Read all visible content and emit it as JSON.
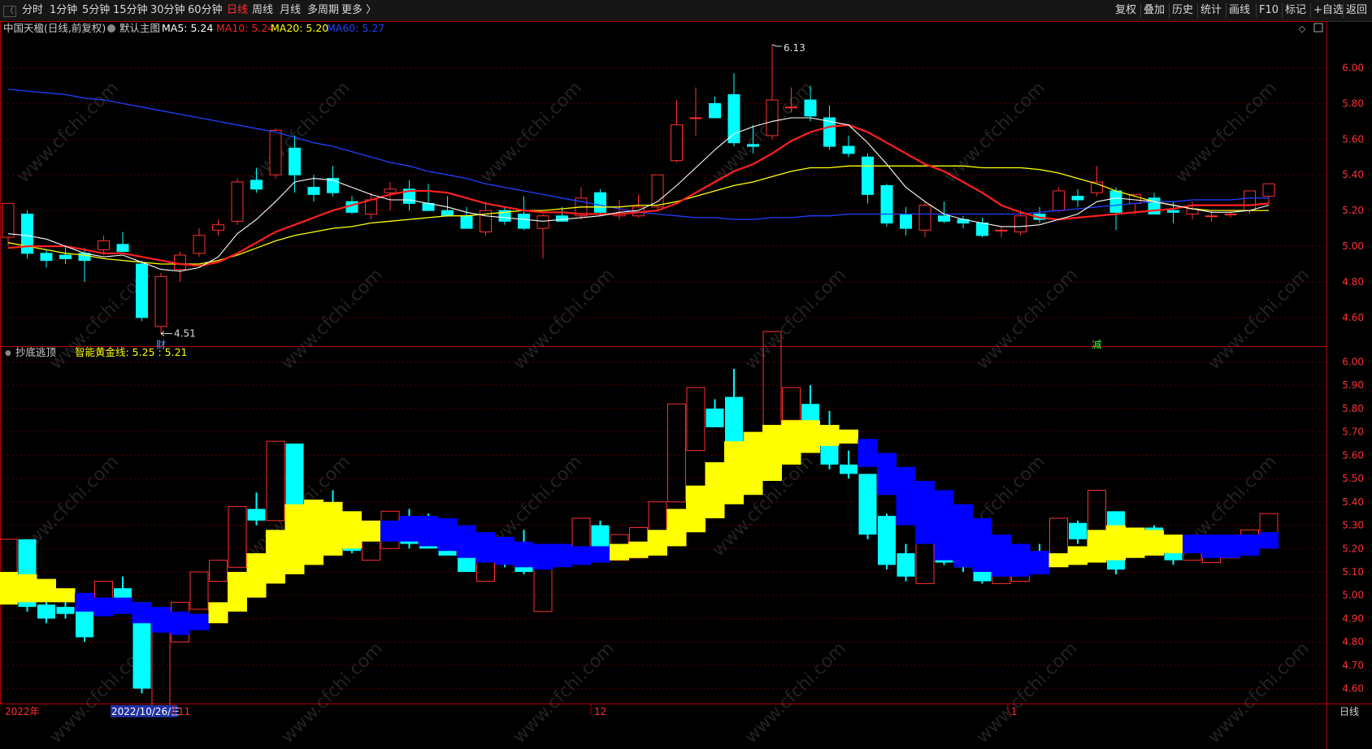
{
  "toolbar": {
    "collapse_glyph": "〈",
    "periods": [
      "分时",
      "1分钟",
      "5分钟",
      "15分钟",
      "30分钟",
      "60分钟",
      "日线",
      "周线",
      "月线",
      "多周期",
      "更多 〉"
    ],
    "active_period": "日线",
    "right_buttons": [
      "复权",
      "叠加",
      "历史",
      "统计",
      "画线",
      "F10",
      "标记",
      "+自选",
      "返回"
    ]
  },
  "main_panel": {
    "stock_title": "中国天楹(日线,前复权)",
    "template_label": "默认主图",
    "ma_legend": [
      {
        "label": "MA5: 5.24",
        "color": "#ffffff"
      },
      {
        "label": "MA10: 5.24",
        "color": "#ff2020"
      },
      {
        "label": "MA20: 5.20",
        "color": "#ffff00"
      },
      {
        "label": "MA60: 5.27",
        "color": "#2040ff"
      }
    ],
    "high_marker": "6.13",
    "low_marker": "4.51",
    "event_badge_finance": "财",
    "event_badge_reduce": "减",
    "y_ticks": [
      "6.00",
      "5.80",
      "5.60",
      "5.40",
      "5.20",
      "5.00",
      "4.80",
      "4.60"
    ]
  },
  "sub_panel": {
    "indicator_name": "抄底逃顶",
    "line_label": "智能黄金线: 5.25 : 5.21",
    "y_ticks": [
      "6.00",
      "5.90",
      "5.80",
      "5.70",
      "5.60",
      "5.50",
      "5.40",
      "5.30",
      "5.20",
      "5.10",
      "5.00",
      "4.90",
      "4.80",
      "4.70",
      "4.60"
    ]
  },
  "x_axis": {
    "year_label": "2022年",
    "cursor_date": "2022/10/26/三",
    "month_labels": [
      "11",
      "12",
      "1"
    ]
  },
  "period_footer": "日线",
  "watermark": "www.cfchi.com",
  "colors": {
    "up": "#ff3030",
    "down": "#00ffff",
    "ma5": "#ffffff",
    "ma10": "#ff2020",
    "ma20": "#ffff00",
    "ma60": "#2040ff",
    "gold_line_up": "#ffff00",
    "gold_line_down": "#0000ff",
    "grid": "#5a0000",
    "axis": "#b00000"
  },
  "chart_data": {
    "type": "candlestick",
    "series": [
      {
        "o": 5.05,
        "h": 5.18,
        "l": 5.0,
        "c": 5.24
      },
      {
        "o": 5.18,
        "h": 5.2,
        "l": 4.93,
        "c": 4.96
      },
      {
        "o": 4.96,
        "h": 4.98,
        "l": 4.88,
        "c": 4.92
      },
      {
        "o": 4.95,
        "h": 5.0,
        "l": 4.9,
        "c": 4.93
      },
      {
        "o": 4.96,
        "h": 4.99,
        "l": 4.8,
        "c": 4.92
      },
      {
        "o": 4.98,
        "h": 5.06,
        "l": 4.95,
        "c": 5.03
      },
      {
        "o": 5.01,
        "h": 5.08,
        "l": 4.98,
        "c": 4.97
      },
      {
        "o": 4.9,
        "h": 4.92,
        "l": 4.58,
        "c": 4.6
      },
      {
        "o": 4.55,
        "h": 4.85,
        "l": 4.51,
        "c": 4.83
      },
      {
        "o": 4.87,
        "h": 4.97,
        "l": 4.8,
        "c": 4.95
      },
      {
        "o": 4.96,
        "h": 5.1,
        "l": 4.94,
        "c": 5.06
      },
      {
        "o": 5.09,
        "h": 5.15,
        "l": 5.06,
        "c": 5.12
      },
      {
        "o": 5.14,
        "h": 5.38,
        "l": 5.12,
        "c": 5.36
      },
      {
        "o": 5.37,
        "h": 5.44,
        "l": 5.3,
        "c": 5.32
      },
      {
        "o": 5.4,
        "h": 5.66,
        "l": 5.38,
        "c": 5.65
      },
      {
        "o": 5.55,
        "h": 5.62,
        "l": 5.3,
        "c": 5.4
      },
      {
        "o": 5.33,
        "h": 5.4,
        "l": 5.25,
        "c": 5.29
      },
      {
        "o": 5.38,
        "h": 5.45,
        "l": 5.28,
        "c": 5.3
      },
      {
        "o": 5.25,
        "h": 5.28,
        "l": 5.18,
        "c": 5.19
      },
      {
        "o": 5.18,
        "h": 5.3,
        "l": 5.15,
        "c": 5.26
      },
      {
        "o": 5.3,
        "h": 5.36,
        "l": 5.2,
        "c": 5.32
      },
      {
        "o": 5.32,
        "h": 5.37,
        "l": 5.2,
        "c": 5.24
      },
      {
        "o": 5.24,
        "h": 5.35,
        "l": 5.2,
        "c": 5.2
      },
      {
        "o": 5.2,
        "h": 5.28,
        "l": 5.18,
        "c": 5.17
      },
      {
        "o": 5.17,
        "h": 5.22,
        "l": 5.1,
        "c": 5.1
      },
      {
        "o": 5.08,
        "h": 5.25,
        "l": 5.06,
        "c": 5.2
      },
      {
        "o": 5.2,
        "h": 5.22,
        "l": 5.12,
        "c": 5.14
      },
      {
        "o": 5.18,
        "h": 5.28,
        "l": 5.09,
        "c": 5.1
      },
      {
        "o": 5.1,
        "h": 5.18,
        "l": 4.93,
        "c": 5.17
      },
      {
        "o": 5.17,
        "h": 5.22,
        "l": 5.14,
        "c": 5.14
      },
      {
        "o": 5.17,
        "h": 5.33,
        "l": 5.15,
        "c": 5.27
      },
      {
        "o": 5.3,
        "h": 5.32,
        "l": 5.17,
        "c": 5.19
      },
      {
        "o": 5.17,
        "h": 5.26,
        "l": 5.15,
        "c": 5.18
      },
      {
        "o": 5.17,
        "h": 5.29,
        "l": 5.16,
        "c": 5.22
      },
      {
        "o": 5.22,
        "h": 5.4,
        "l": 5.2,
        "c": 5.4
      },
      {
        "o": 5.48,
        "h": 5.82,
        "l": 5.47,
        "c": 5.68
      },
      {
        "o": 5.72,
        "h": 5.89,
        "l": 5.62,
        "c": 5.72
      },
      {
        "o": 5.8,
        "h": 5.84,
        "l": 5.72,
        "c": 5.72
      },
      {
        "o": 5.85,
        "h": 5.97,
        "l": 5.56,
        "c": 5.58
      },
      {
        "o": 5.57,
        "h": 5.68,
        "l": 5.52,
        "c": 5.56
      },
      {
        "o": 5.62,
        "h": 6.13,
        "l": 5.6,
        "c": 5.82
      },
      {
        "o": 5.78,
        "h": 5.89,
        "l": 5.75,
        "c": 5.78
      },
      {
        "o": 5.82,
        "h": 5.9,
        "l": 5.7,
        "c": 5.73
      },
      {
        "o": 5.72,
        "h": 5.79,
        "l": 5.54,
        "c": 5.56
      },
      {
        "o": 5.56,
        "h": 5.62,
        "l": 5.5,
        "c": 5.52
      },
      {
        "o": 5.5,
        "h": 5.52,
        "l": 5.24,
        "c": 5.29
      },
      {
        "o": 5.34,
        "h": 5.35,
        "l": 5.11,
        "c": 5.13
      },
      {
        "o": 5.18,
        "h": 5.22,
        "l": 5.06,
        "c": 5.1
      },
      {
        "o": 5.09,
        "h": 5.25,
        "l": 5.05,
        "c": 5.23
      },
      {
        "o": 5.17,
        "h": 5.25,
        "l": 5.13,
        "c": 5.14
      },
      {
        "o": 5.15,
        "h": 5.17,
        "l": 5.1,
        "c": 5.13
      },
      {
        "o": 5.13,
        "h": 5.16,
        "l": 5.05,
        "c": 5.06
      },
      {
        "o": 5.09,
        "h": 5.11,
        "l": 5.05,
        "c": 5.09
      },
      {
        "o": 5.08,
        "h": 5.2,
        "l": 5.06,
        "c": 5.17
      },
      {
        "o": 5.18,
        "h": 5.22,
        "l": 5.13,
        "c": 5.15
      },
      {
        "o": 5.2,
        "h": 5.33,
        "l": 5.19,
        "c": 5.31
      },
      {
        "o": 5.28,
        "h": 5.32,
        "l": 5.22,
        "c": 5.26
      },
      {
        "o": 5.3,
        "h": 5.45,
        "l": 5.28,
        "c": 5.36
      },
      {
        "o": 5.31,
        "h": 5.33,
        "l": 5.09,
        "c": 5.19
      },
      {
        "o": 5.24,
        "h": 5.28,
        "l": 5.18,
        "c": 5.29
      },
      {
        "o": 5.27,
        "h": 5.3,
        "l": 5.18,
        "c": 5.18
      },
      {
        "o": 5.2,
        "h": 5.25,
        "l": 5.13,
        "c": 5.19
      },
      {
        "o": 5.18,
        "h": 5.25,
        "l": 5.15,
        "c": 5.21
      },
      {
        "o": 5.17,
        "h": 5.2,
        "l": 5.14,
        "c": 5.17
      },
      {
        "o": 5.18,
        "h": 5.2,
        "l": 5.16,
        "c": 5.18
      },
      {
        "o": 5.2,
        "h": 5.28,
        "l": 5.18,
        "c": 5.31
      },
      {
        "o": 5.28,
        "h": 5.35,
        "l": 5.24,
        "c": 5.35
      }
    ],
    "ma5": [
      5.07,
      5.06,
      5.04,
      5.0,
      4.96,
      4.94,
      4.95,
      4.91,
      4.87,
      4.86,
      4.88,
      4.94,
      5.07,
      5.15,
      5.25,
      5.36,
      5.38,
      5.37,
      5.33,
      5.29,
      5.26,
      5.26,
      5.24,
      5.22,
      5.19,
      5.17,
      5.16,
      5.15,
      5.14,
      5.15,
      5.16,
      5.17,
      5.19,
      5.2,
      5.25,
      5.34,
      5.44,
      5.54,
      5.63,
      5.67,
      5.7,
      5.72,
      5.72,
      5.7,
      5.68,
      5.58,
      5.46,
      5.33,
      5.25,
      5.18,
      5.15,
      5.13,
      5.11,
      5.11,
      5.12,
      5.15,
      5.18,
      5.25,
      5.27,
      5.26,
      5.25,
      5.23,
      5.21,
      5.19,
      5.19,
      5.2,
      5.23
    ],
    "ma10": [
      4.99,
      5.0,
      5.0,
      5.0,
      4.98,
      4.96,
      4.96,
      4.94,
      4.92,
      4.9,
      4.89,
      4.91,
      4.96,
      5.02,
      5.08,
      5.12,
      5.16,
      5.2,
      5.23,
      5.26,
      5.29,
      5.31,
      5.31,
      5.3,
      5.27,
      5.24,
      5.22,
      5.2,
      5.19,
      5.19,
      5.18,
      5.18,
      5.18,
      5.19,
      5.2,
      5.24,
      5.3,
      5.36,
      5.42,
      5.46,
      5.52,
      5.59,
      5.64,
      5.67,
      5.68,
      5.64,
      5.58,
      5.52,
      5.46,
      5.42,
      5.36,
      5.3,
      5.23,
      5.19,
      5.16,
      5.15,
      5.16,
      5.17,
      5.18,
      5.19,
      5.2,
      5.21,
      5.23,
      5.23,
      5.23,
      5.23,
      5.24
    ],
    "ma20": [
      5.02,
      5.0,
      4.98,
      4.96,
      4.95,
      4.93,
      4.92,
      4.91,
      4.9,
      4.9,
      4.9,
      4.92,
      4.95,
      4.99,
      5.03,
      5.06,
      5.08,
      5.1,
      5.11,
      5.13,
      5.14,
      5.15,
      5.16,
      5.17,
      5.17,
      5.18,
      5.19,
      5.2,
      5.2,
      5.21,
      5.22,
      5.22,
      5.22,
      5.23,
      5.23,
      5.25,
      5.28,
      5.31,
      5.34,
      5.36,
      5.39,
      5.42,
      5.44,
      5.44,
      5.45,
      5.45,
      5.45,
      5.45,
      5.45,
      5.45,
      5.45,
      5.44,
      5.44,
      5.44,
      5.43,
      5.41,
      5.38,
      5.35,
      5.31,
      5.28,
      5.25,
      5.23,
      5.21,
      5.2,
      5.2,
      5.2,
      5.2
    ],
    "ma60": [
      5.88,
      5.87,
      5.86,
      5.85,
      5.83,
      5.82,
      5.8,
      5.78,
      5.76,
      5.74,
      5.72,
      5.7,
      5.68,
      5.66,
      5.64,
      5.61,
      5.58,
      5.56,
      5.53,
      5.5,
      5.47,
      5.45,
      5.42,
      5.4,
      5.38,
      5.35,
      5.33,
      5.31,
      5.29,
      5.27,
      5.25,
      5.23,
      5.21,
      5.19,
      5.18,
      5.17,
      5.16,
      5.16,
      5.15,
      5.15,
      5.16,
      5.16,
      5.17,
      5.17,
      5.18,
      5.18,
      5.18,
      5.18,
      5.18,
      5.18,
      5.18,
      5.18,
      5.18,
      5.18,
      5.19,
      5.2,
      5.21,
      5.22,
      5.23,
      5.24,
      5.25,
      5.25,
      5.26,
      5.26,
      5.26,
      5.27,
      5.27
    ],
    "main_ylim": [
      4.44,
      6.18
    ],
    "sub_ylim": [
      4.55,
      6.04
    ]
  }
}
